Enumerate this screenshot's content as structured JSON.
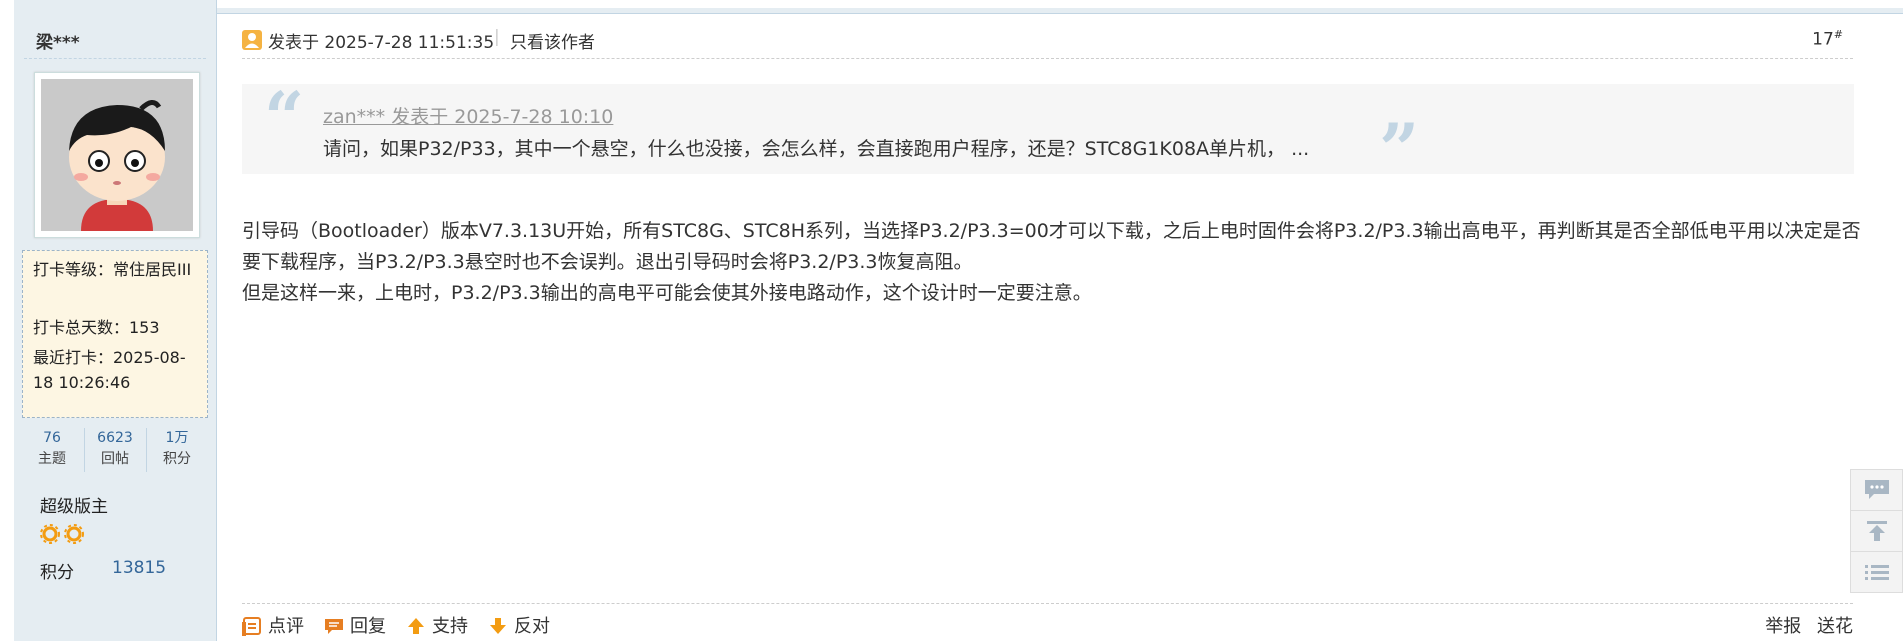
{
  "author": {
    "username": "梁***",
    "checkin": {
      "level": "打卡等级：常住居民III",
      "total_days": "打卡总天数：153",
      "last": "最近打卡：2025-08-18 10:26:46"
    },
    "stats": [
      {
        "value": "76",
        "label": "主题"
      },
      {
        "value": "6623",
        "label": "回帖"
      },
      {
        "value": "1万",
        "label": "积分"
      }
    ],
    "rank": "超级版主",
    "points_label": "积分",
    "points_value": "13815"
  },
  "post": {
    "date_text": "发表于 2025-7-28 11:51:35",
    "separator": "|",
    "only_author": "只看该作者",
    "floor_number": "17",
    "floor_sup": "#",
    "quote": {
      "source": "zan*** 发表于 2025-7-28 10:10",
      "text": "请问，如果P32/P33，其中一个悬空，什么也没接，会怎么样，会直接跑用户程序，还是？STC8G1K08A单片机， ..."
    },
    "body_lines": [
      "引导码（Bootloader）版本V7.3.13U开始，所有STC8G、STC8H系列，当选择P3.2/P3.3=00才可以下载，之后上电时固件会将P3.2/P3.3输出高电平，再判断其是否全部低电平用以决定是否要下载程序，当P3.2/P3.3悬空时也不会误判。退出引导码时会将P3.2/P3.3恢复高阻。",
      "但是这样一来，上电时，P3.2/P3.3输出的高电平可能会使其外接电路动作，这个设计时一定要注意。"
    ],
    "actions": {
      "comment": "点评",
      "reply": "回复",
      "support": "支持",
      "oppose": "反对",
      "report": "举报",
      "gift": "送花"
    }
  },
  "colors": {
    "sidebar_bg": "#e5edf2",
    "border": "#c2d5e3",
    "link_blue": "#336699",
    "action_orange": "#f39c12"
  }
}
